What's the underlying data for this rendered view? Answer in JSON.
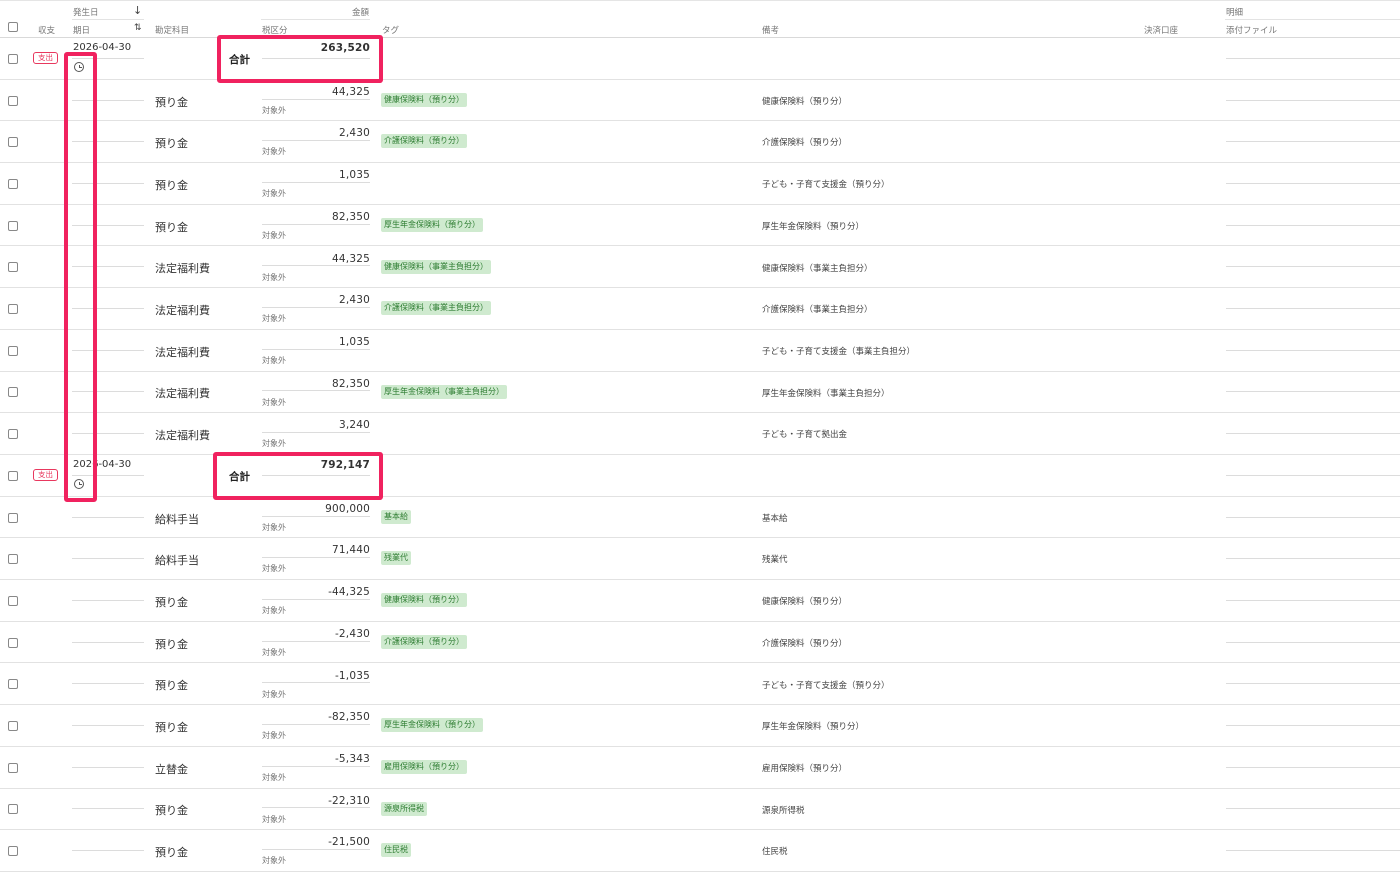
{
  "header": {
    "col_type": "収支",
    "col_occurred": "発生日",
    "col_due": "期日",
    "col_account": "勘定科目",
    "col_amount": "金額",
    "col_tax": "税区分",
    "col_tag": "タグ",
    "col_memo": "備考",
    "col_wallet": "決済口座",
    "col_detail": "明細",
    "col_attach": "添付ファイル",
    "sort_down_icon": "↓",
    "sort_both_icon": "⇅"
  },
  "colors": {
    "highlight": "#f0225f",
    "badge": "#e8385e",
    "tag_bg": "#cfeacf",
    "tag_text": "#2e7d32"
  },
  "rows": [
    {
      "kind": "total",
      "badge": "支出",
      "date": "2026-04-30",
      "total_label": "合計",
      "amount": "263,520"
    },
    {
      "kind": "line",
      "account": "預り金",
      "amount": "44,325",
      "tax": "対象外",
      "tag": "健康保険料（預り分）",
      "memo": "健康保険料（預り分）"
    },
    {
      "kind": "line",
      "account": "預り金",
      "amount": "2,430",
      "tax": "対象外",
      "tag": "介護保険料（預り分）",
      "memo": "介護保険料（預り分）"
    },
    {
      "kind": "line",
      "account": "預り金",
      "amount": "1,035",
      "tax": "対象外",
      "tag": "",
      "memo": "子ども・子育て支援金（預り分）"
    },
    {
      "kind": "line",
      "account": "預り金",
      "amount": "82,350",
      "tax": "対象外",
      "tag": "厚生年金保険料（預り分）",
      "memo": "厚生年金保険料（預り分）"
    },
    {
      "kind": "line",
      "account": "法定福利費",
      "amount": "44,325",
      "tax": "対象外",
      "tag": "健康保険料（事業主負担分）",
      "memo": "健康保険料（事業主負担分）"
    },
    {
      "kind": "line",
      "account": "法定福利費",
      "amount": "2,430",
      "tax": "対象外",
      "tag": "介護保険料（事業主負担分）",
      "memo": "介護保険料（事業主負担分）"
    },
    {
      "kind": "line",
      "account": "法定福利費",
      "amount": "1,035",
      "tax": "対象外",
      "tag": "",
      "memo": "子ども・子育て支援金（事業主負担分）"
    },
    {
      "kind": "line",
      "account": "法定福利費",
      "amount": "82,350",
      "tax": "対象外",
      "tag": "厚生年金保険料（事業主負担分）",
      "memo": "厚生年金保険料（事業主負担分）"
    },
    {
      "kind": "line",
      "account": "法定福利費",
      "amount": "3,240",
      "tax": "対象外",
      "tag": "",
      "memo": "子ども・子育て拠出金"
    },
    {
      "kind": "total",
      "badge": "支出",
      "date": "2026-04-30",
      "total_label": "合計",
      "amount": "792,147"
    },
    {
      "kind": "line",
      "account": "給料手当",
      "amount": "900,000",
      "tax": "対象外",
      "tag": "基本給",
      "memo": "基本給"
    },
    {
      "kind": "line",
      "account": "給料手当",
      "amount": "71,440",
      "tax": "対象外",
      "tag": "残業代",
      "memo": "残業代"
    },
    {
      "kind": "line",
      "account": "預り金",
      "amount": "-44,325",
      "tax": "対象外",
      "tag": "健康保険料（預り分）",
      "memo": "健康保険料（預り分）"
    },
    {
      "kind": "line",
      "account": "預り金",
      "amount": "-2,430",
      "tax": "対象外",
      "tag": "介護保険料（預り分）",
      "memo": "介護保険料（預り分）"
    },
    {
      "kind": "line",
      "account": "預り金",
      "amount": "-1,035",
      "tax": "対象外",
      "tag": "",
      "memo": "子ども・子育て支援金（預り分）"
    },
    {
      "kind": "line",
      "account": "預り金",
      "amount": "-82,350",
      "tax": "対象外",
      "tag": "厚生年金保険料（預り分）",
      "memo": "厚生年金保険料（預り分）"
    },
    {
      "kind": "line",
      "account": "立替金",
      "amount": "-5,343",
      "tax": "対象外",
      "tag": "雇用保険料（預り分）",
      "memo": "雇用保険料（預り分）"
    },
    {
      "kind": "line",
      "account": "預り金",
      "amount": "-22,310",
      "tax": "対象外",
      "tag": "源泉所得税",
      "memo": "源泉所得税"
    },
    {
      "kind": "line",
      "account": "預り金",
      "amount": "-21,500",
      "tax": "対象外",
      "tag": "住民税",
      "memo": "住民税"
    }
  ]
}
